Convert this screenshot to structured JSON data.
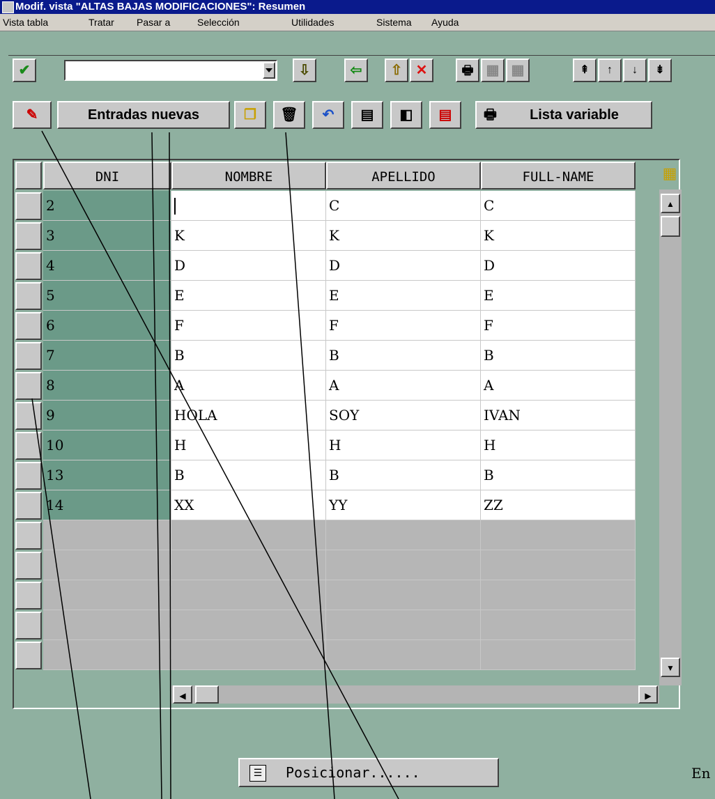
{
  "window": {
    "title": "Modif. vista \"ALTAS BAJAS MODIFICACIONES\": Resumen"
  },
  "menu": {
    "items": [
      "Vista tabla",
      "Tratar",
      "Pasar a",
      "Selección",
      "Utilidades",
      "Sistema",
      "Ayuda"
    ]
  },
  "toolbar": {
    "command_value": "",
    "icons": [
      "check-icon",
      "dropdown-icon",
      "save-icon",
      "back-icon",
      "exit-icon",
      "cancel-icon",
      "print-icon",
      "find-icon",
      "find-next-icon",
      "first-page-icon",
      "prev-page-icon",
      "next-page-icon",
      "last-page-icon"
    ]
  },
  "app_toolbar": {
    "new_entries_label": "Entradas nuevas",
    "variable_list_label": "Lista variable",
    "icons": [
      "display-change-icon",
      "copy-icon",
      "delete-icon",
      "undo-icon",
      "select-all-icon",
      "select-block-icon",
      "deselect-all-icon",
      "print-list-icon"
    ]
  },
  "table": {
    "columns": [
      "DNI",
      "NOMBRE",
      "APELLIDO",
      "FULL-NAME"
    ],
    "rows": [
      {
        "dni": "2",
        "nombre": "",
        "apellido": "C",
        "full_name": "C"
      },
      {
        "dni": "3",
        "nombre": "K",
        "apellido": "K",
        "full_name": "K"
      },
      {
        "dni": "4",
        "nombre": "D",
        "apellido": "D",
        "full_name": "D"
      },
      {
        "dni": "5",
        "nombre": "E",
        "apellido": "E",
        "full_name": "E"
      },
      {
        "dni": "6",
        "nombre": "F",
        "apellido": "F",
        "full_name": "F"
      },
      {
        "dni": "7",
        "nombre": "B",
        "apellido": "B",
        "full_name": "B"
      },
      {
        "dni": "8",
        "nombre": "A",
        "apellido": "A",
        "full_name": "A"
      },
      {
        "dni": "9",
        "nombre": "HOLA",
        "apellido": "SOY",
        "full_name": "IVAN"
      },
      {
        "dni": "10",
        "nombre": "H",
        "apellido": "H",
        "full_name": "H"
      },
      {
        "dni": "13",
        "nombre": "B",
        "apellido": "B",
        "full_name": "B"
      },
      {
        "dni": "14",
        "nombre": "XX",
        "apellido": "YY",
        "full_name": "ZZ"
      }
    ],
    "empty_rows": 5
  },
  "footer": {
    "position_label": "Posicionar......",
    "entries_label": "En"
  }
}
